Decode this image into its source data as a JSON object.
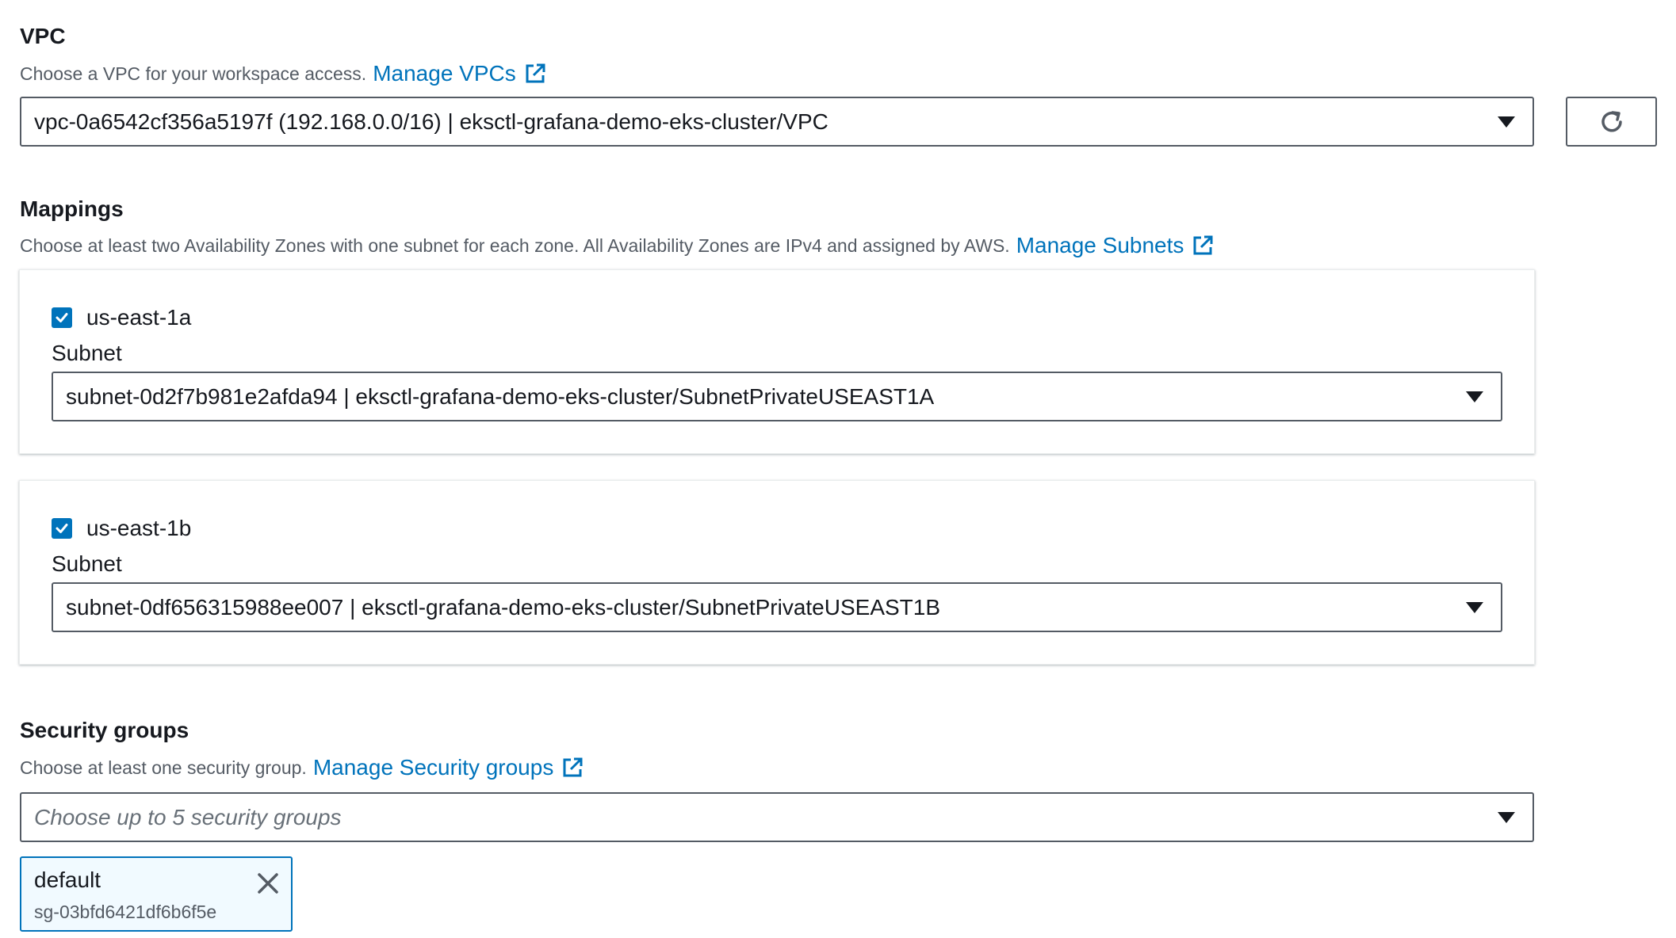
{
  "vpc": {
    "title": "VPC",
    "description": "Choose a VPC for your workspace access.",
    "manage_link": "Manage VPCs",
    "selected": "vpc-0a6542cf356a5197f (192.168.0.0/16) | eksctl-grafana-demo-eks-cluster/VPC",
    "refresh_icon": "refresh-icon"
  },
  "mappings": {
    "title": "Mappings",
    "description": "Choose at least two Availability Zones with one subnet for each zone. All Availability Zones are IPv4 and assigned by AWS.",
    "manage_link": "Manage Subnets",
    "zones": [
      {
        "name": "us-east-1a",
        "checked": true,
        "subnet_label": "Subnet",
        "subnet_value": "subnet-0d2f7b981e2afda94 | eksctl-grafana-demo-eks-cluster/SubnetPrivateUSEAST1A"
      },
      {
        "name": "us-east-1b",
        "checked": true,
        "subnet_label": "Subnet",
        "subnet_value": "subnet-0df656315988ee007 | eksctl-grafana-demo-eks-cluster/SubnetPrivateUSEAST1B"
      }
    ]
  },
  "security_groups": {
    "title": "Security groups",
    "description": "Choose at least one security group.",
    "manage_link": "Manage Security groups",
    "placeholder": "Choose up to 5 security groups",
    "selected": [
      {
        "name": "default",
        "id": "sg-03bfd6421df6b6f5e"
      }
    ]
  },
  "colors": {
    "link": "#0073bb",
    "text": "#16191f",
    "muted": "#545b64",
    "token_bg": "#f1faff"
  }
}
